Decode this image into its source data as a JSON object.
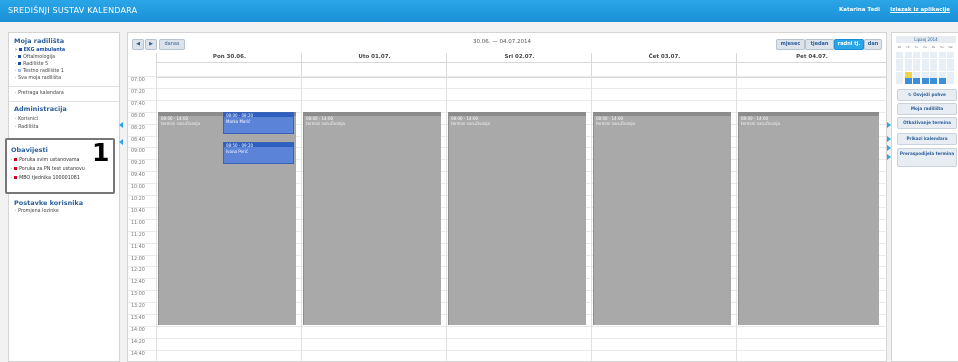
{
  "header": {
    "app_title": "SREDIŠNJI SUSTAV KALENDARA",
    "user": "Katarina Tedi",
    "logout": "Izlazak iz aplikacije",
    "brand_color": "#2aa6e8"
  },
  "sidebar": {
    "my_units_title": "Moja radilišta",
    "units": [
      "EKG ambulanta",
      "Oftalmologija",
      "Radilište 5",
      "Testno radilište 1",
      "Sva moja radilišta"
    ],
    "search_calendar": "Pretraga kalendara",
    "admin_title": "Administracija",
    "admin_items": [
      "Korisnici",
      "Radilišta"
    ],
    "notifications_title": "Obavijesti",
    "notifications": [
      "Poruka svim ustanovama",
      "Poruka za PN test ustanovu",
      "MBO tjednika 100001081"
    ],
    "callout_number": "1",
    "account_title": "Postavke korisnika",
    "account_items": [
      "Promjena lozinke"
    ]
  },
  "toolbar": {
    "prev_icon": "◀",
    "next_icon": "▶",
    "today": "danas",
    "range": "30.06. — 04.07.2014",
    "views": [
      "mjesec",
      "tjedan",
      "radni tj.",
      "dan"
    ],
    "active_view": "radni tj."
  },
  "days": [
    "Pon 30.06.",
    "Uto 01.07.",
    "Sri 02.07.",
    "Čet 03.07.",
    "Pet 04.07."
  ],
  "times": [
    "07:00",
    "07:20",
    "07:40",
    "08:00",
    "08:20",
    "08:40",
    "09:00",
    "09:20",
    "09:40",
    "10:00",
    "10:20",
    "10:40",
    "11:00",
    "11:20",
    "11:40",
    "12:00",
    "12:20",
    "12:40",
    "13:00",
    "13:20",
    "13:40",
    "14:00",
    "14:20",
    "14:40"
  ],
  "blocks": [
    {
      "time": "08:00 - 14:00",
      "label": "termini naručivanja"
    },
    {
      "time": "08:00 - 14:00",
      "label": "termini naručivanja"
    },
    {
      "time": "08:00 - 14:00",
      "label": "termini naručivanja"
    },
    {
      "time": "08:00 - 14:00",
      "label": "termini naručivanja"
    },
    {
      "time": "08:00 - 14:00",
      "label": "termini naručivanja"
    }
  ],
  "appointments": [
    {
      "time": "08:00 - 08:20",
      "name": "Marko Marić"
    },
    {
      "time": "08:50 - 09:20",
      "name": "Ivana Perić"
    }
  ],
  "mini_calendar": {
    "title": "Lipanj 2014",
    "weekdays": [
      "Po",
      "Ut",
      "Sr",
      "Če",
      "Pe",
      "Su",
      "Ne"
    ],
    "today_cell": 22,
    "week_cells": [
      29,
      30,
      31,
      32,
      33
    ]
  },
  "right_panel": {
    "buttons": [
      "Osvježi pohve",
      "Moja radilišta",
      "Otkaživanje termina",
      "Prikazi kalendara",
      "Preraspodijela termina"
    ]
  }
}
